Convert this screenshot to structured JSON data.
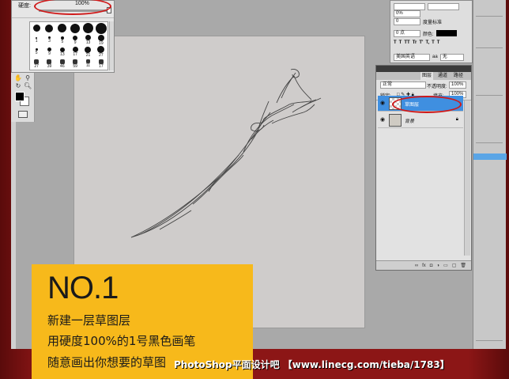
{
  "brush_panel": {
    "hardness_label": "硬度:",
    "hardness_value": "100%",
    "presets": [
      {
        "size": ""
      },
      {
        "size": ""
      },
      {
        "size": ""
      },
      {
        "size": ""
      },
      {
        "size": ""
      },
      {
        "size": ""
      },
      {
        "size": "1"
      },
      {
        "size": "3"
      },
      {
        "size": "5"
      },
      {
        "size": "9"
      },
      {
        "size": "13"
      },
      {
        "size": "19"
      },
      {
        "size": "5"
      },
      {
        "size": "9"
      },
      {
        "size": "13"
      },
      {
        "size": "17"
      },
      {
        "size": "21"
      },
      {
        "size": "27"
      },
      {
        "size": "27"
      },
      {
        "size": "39"
      },
      {
        "size": "46"
      },
      {
        "size": "59"
      },
      {
        "size": "11"
      },
      {
        "size": "17"
      }
    ],
    "preset_labels_row3": [
      "",
      "",
      "",
      "",
      "14",
      "24"
    ],
    "preset_labels_row4": [
      "27",
      "39",
      "46",
      "59",
      "11",
      "17"
    ]
  },
  "char_panel": {
    "tracking": "0%",
    "kerning": "0",
    "baseline": "0 点",
    "color_label": "颜色:",
    "vertical_scale_label": "度量标准",
    "language": "美国英语",
    "antialias": "无",
    "style_buttons": [
      "T",
      "T",
      "TT",
      "Tr",
      "T'",
      "T,",
      "T",
      "T"
    ]
  },
  "layers_panel": {
    "tabs": [
      "图层",
      "通道",
      "路径"
    ],
    "active_tab": "图层",
    "blend_mode": "正常",
    "opacity_label": "不透明度:",
    "opacity_value": "100%",
    "lock_label": "锁定:",
    "fill_label": "填充:",
    "fill_value": "100%",
    "layers": [
      {
        "name": "草图层",
        "selected": true
      },
      {
        "name": "背景",
        "selected": false
      }
    ]
  },
  "caption": {
    "title": "NO.1",
    "lines": [
      "新建一层草图层",
      "用硬度100%的1号黑色画笔",
      "随意画出你想要的草图"
    ]
  },
  "footer": {
    "text": "PhotoShop平面设计吧  【www.linecg.com/tieba/1783】"
  },
  "colors": {
    "frame_red": "#8c1616",
    "caption_yellow": "#f7b91b",
    "selection_blue": "#3f8fe0",
    "annotation_red": "#d01818"
  }
}
